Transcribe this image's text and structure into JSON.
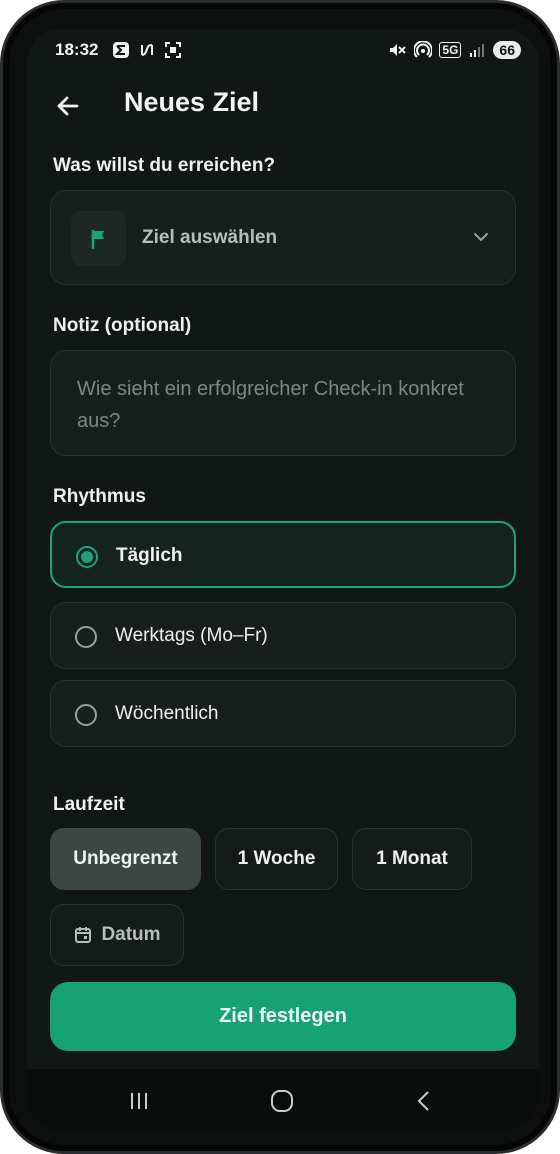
{
  "status_bar": {
    "time": "18:32",
    "network": "5G",
    "battery": "66"
  },
  "app_bar": {
    "title": "Neues Ziel",
    "back_icon": "arrow-left-icon"
  },
  "goal_section": {
    "label": "Was willst du erreichen?",
    "select_value": "Ziel auswählen",
    "flag_icon": "flag-icon",
    "chevron_icon": "chevron-down-icon"
  },
  "note_section": {
    "label": "Notiz (optional)",
    "placeholder": "Wie sieht ein erfolgreicher Check-in konkret aus?"
  },
  "rhythm_section": {
    "label": "Rhythmus",
    "options": [
      {
        "label": "Täglich",
        "selected": true
      },
      {
        "label": "Werktags (Mo–Fr)",
        "selected": false
      },
      {
        "label": "Wöchentlich",
        "selected": false
      }
    ]
  },
  "duration_section": {
    "label": "Laufzeit",
    "chips": [
      {
        "label": "Unbegrenzt",
        "active": true
      },
      {
        "label": "1 Woche",
        "active": false
      },
      {
        "label": "1 Monat",
        "active": false
      }
    ],
    "date_chip": {
      "label": "Datum",
      "icon": "calendar-icon"
    }
  },
  "cta": {
    "label": "Ziel festlegen"
  },
  "colors": {
    "accent": "#17a273",
    "background": "#111715",
    "card": "#171e1c"
  }
}
